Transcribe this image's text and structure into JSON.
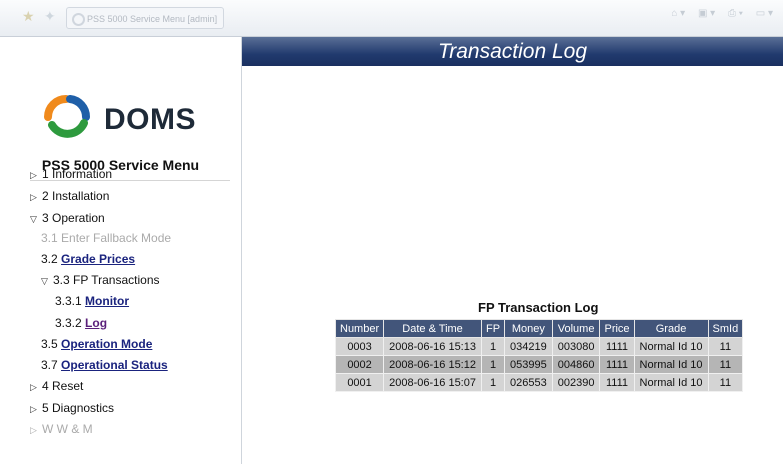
{
  "browser": {
    "tab_title": "PSS 5000 Service Menu [admin]"
  },
  "sidebar": {
    "logo_text": "DOMS",
    "menu_title": "PSS 5000 Service Menu",
    "items": [
      {
        "label": "1 Information"
      },
      {
        "label": "2 Installation"
      },
      {
        "label": "3 Operation"
      },
      {
        "label": "3.1 Enter Fallback Mode"
      },
      {
        "prefix": "3.2",
        "link": "Grade Prices"
      },
      {
        "label": "3.3 FP Transactions"
      },
      {
        "prefix": "3.3.1",
        "link": "Monitor"
      },
      {
        "prefix": "3.3.2",
        "link": "Log"
      },
      {
        "prefix": "3.5",
        "link": "Operation Mode"
      },
      {
        "prefix": "3.7",
        "link": "Operational Status"
      },
      {
        "label": "4 Reset"
      },
      {
        "label": "5 Diagnostics"
      },
      {
        "label": "W W & M"
      }
    ]
  },
  "main": {
    "page_title": "Transaction Log",
    "table_caption": "FP Transaction Log",
    "columns": [
      "Number",
      "Date & Time",
      "FP",
      "Money",
      "Volume",
      "Price",
      "Grade",
      "SmId"
    ],
    "rows": [
      [
        "0003",
        "2008-06-16 15:13",
        "1",
        "034219",
        "003080",
        "1111",
        "Normal Id 10",
        "11"
      ],
      [
        "0002",
        "2008-06-16 15:12",
        "1",
        "053995",
        "004860",
        "1111",
        "Normal Id 10",
        "11"
      ],
      [
        "0001",
        "2008-06-16 15:07",
        "1",
        "026553",
        "002390",
        "1111",
        "Normal Id 10",
        "11"
      ]
    ]
  },
  "colors": {
    "banner": "#213a6e",
    "table_header": "#42557a",
    "link": "#1a237e",
    "logo_orange": "#f08a1c",
    "logo_blue": "#1f5fa8",
    "logo_green": "#2e9a3e"
  }
}
